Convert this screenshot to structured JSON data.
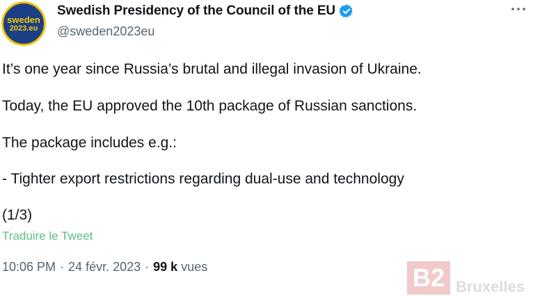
{
  "author": {
    "avatar_line1": "sweden",
    "avatar_line2": "2023.eu",
    "display_name": "Swedish Presidency of the Council of the EU",
    "handle": "@sweden2023eu",
    "verified": true
  },
  "tweet": {
    "paragraphs": [
      "It’s one year since Russia’s brutal and illegal invasion of Ukraine.",
      "Today, the EU approved the 10th package of Russian sanctions.",
      "The package includes e.g.:",
      "- Tighter export restrictions regarding dual-use and technology",
      "(1/3)"
    ],
    "translate_label": "Traduire le Tweet",
    "time": "10:06 PM",
    "separator": "·",
    "date": "24 févr. 2023",
    "views_count": "99 k",
    "views_label": "vues"
  },
  "watermark": {
    "logo": "B2",
    "text": "Bruxelles"
  },
  "colors": {
    "verified_badge": "#1d9bf0",
    "translate_link": "#5bbf8a",
    "muted_text": "#536471"
  },
  "icons": {
    "verified": "verified-badge-icon",
    "more": "more-options-icon"
  }
}
